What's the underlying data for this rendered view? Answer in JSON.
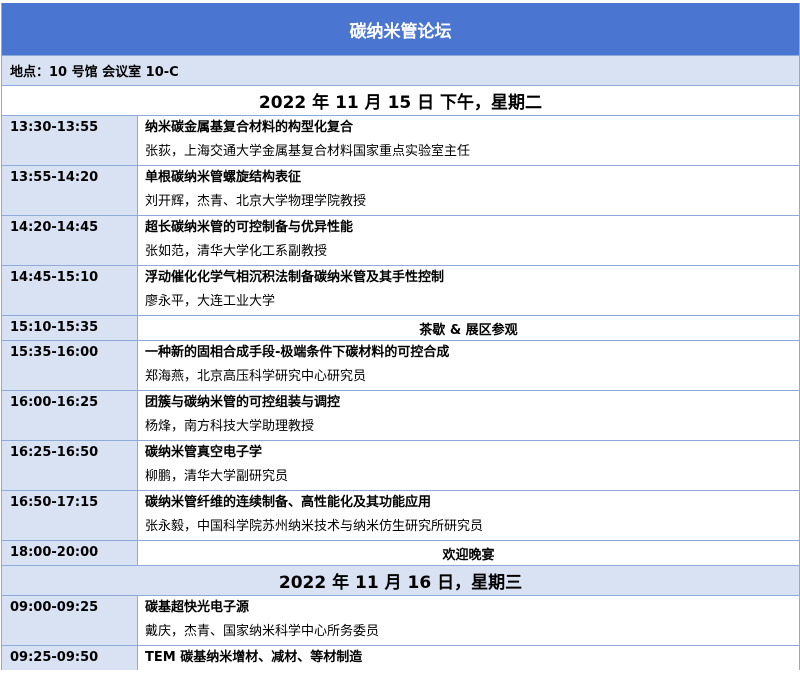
{
  "title": "碳纳米管论坛",
  "location": "地点：10 号馆  会议室 10-C",
  "days": [
    {
      "date": "2022 年 11 月 15 日  下午，星期二",
      "sessions": [
        {
          "time": "13:30-13:55",
          "topic": "纳米碳金属基复合材料的构型化复合",
          "speaker": "张荻，上海交通大学金属基复合材料国家重点实验室主任"
        },
        {
          "time": "13:55-14:20",
          "topic": "单根碳纳米管螺旋结构表征",
          "speaker": "刘开辉，杰青、北京大学物理学院教授"
        },
        {
          "time": "14:20-14:45",
          "topic": "超长碳纳米管的可控制备与优异性能",
          "speaker": "张如范，清华大学化工系副教授"
        },
        {
          "time": "14:45-15:10",
          "topic": "浮动催化化学气相沉积法制备碳纳米管及其手性控制",
          "speaker": "廖永平，大连工业大学"
        },
        {
          "time": "15:10-15:35",
          "topic": "茶歇  &  展区参观",
          "speaker": ""
        },
        {
          "time": "15:35-16:00",
          "topic": "一种新的固相合成手段-极端条件下碳材料的可控合成",
          "speaker": "郑海燕，北京高压科学研究中心研究员"
        },
        {
          "time": "16:00-16:25",
          "topic": "团簇与碳纳米管的可控组装与调控",
          "speaker": "杨烽，南方科技大学助理教授"
        },
        {
          "time": "16:25-16:50",
          "topic": "碳纳米管真空电子学",
          "speaker": "柳鹏，清华大学副研究员"
        },
        {
          "time": "16:50-17:15",
          "topic": "碳纳米管纤维的连续制备、高性能化及其功能应用",
          "speaker": "张永毅，中国科学院苏州纳米技术与纳米仿生研究所研究员"
        },
        {
          "time": "18:00-20:00",
          "topic": "欢迎晚宴",
          "speaker": ""
        }
      ]
    },
    {
      "date": "2022 年 11 月 16 日，星期三",
      "sessions": [
        {
          "time": "09:00-09:25",
          "topic": "碳基超快光电子源",
          "speaker": "戴庆，杰青、国家纳米科学中心所务委员"
        },
        {
          "time": "09:25-09:50",
          "topic": "TEM 碳基纳米增材、减材、等材制造",
          "speaker": ""
        }
      ]
    }
  ]
}
